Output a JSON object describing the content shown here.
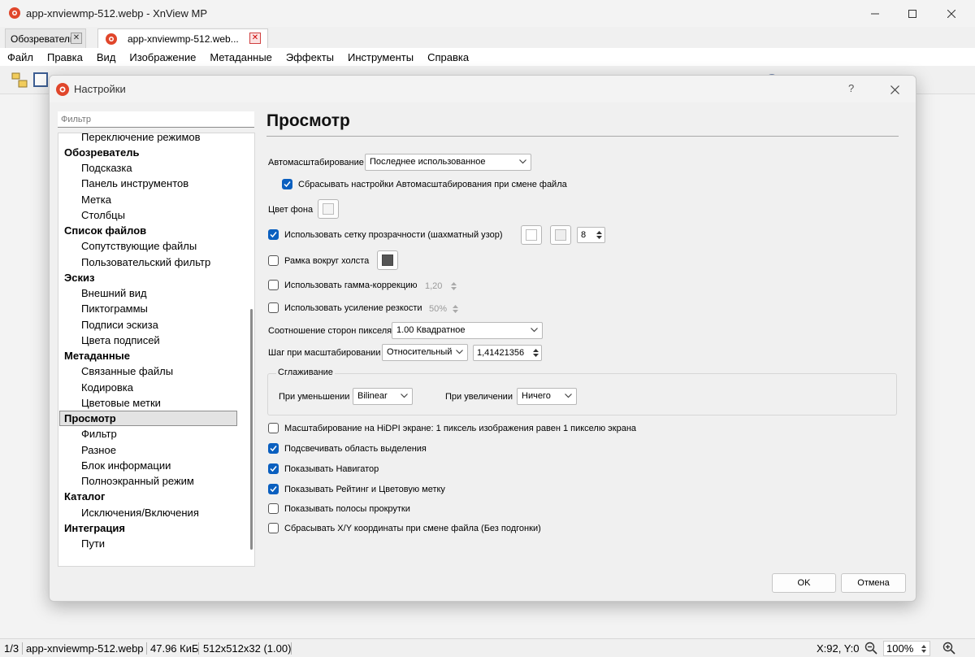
{
  "app": {
    "title": "app-xnviewmp-512.webp - XnView MP"
  },
  "tabs": [
    {
      "label": "Обозреватель"
    },
    {
      "label": "app-xnviewmp-512.web..."
    }
  ],
  "menu": [
    "Файл",
    "Правка",
    "Вид",
    "Изображение",
    "Метаданные",
    "Эффекты",
    "Инструменты",
    "Справка"
  ],
  "dialog": {
    "title": "Настройки",
    "help": "?",
    "filter_placeholder": "Фильтр",
    "tree": [
      {
        "label": "Переключение режимов",
        "level": 2
      },
      {
        "label": "Обозреватель",
        "level": 1
      },
      {
        "label": "Подсказка",
        "level": 2
      },
      {
        "label": "Панель инструментов",
        "level": 2
      },
      {
        "label": "Метка",
        "level": 2
      },
      {
        "label": "Столбцы",
        "level": 2
      },
      {
        "label": "Список файлов",
        "level": 1
      },
      {
        "label": "Сопутствующие файлы",
        "level": 2
      },
      {
        "label": "Пользовательский фильтр",
        "level": 2
      },
      {
        "label": "Эскиз",
        "level": 1
      },
      {
        "label": "Внешний вид",
        "level": 2
      },
      {
        "label": "Пиктограммы",
        "level": 2
      },
      {
        "label": "Подписи эскиза",
        "level": 2
      },
      {
        "label": "Цвета подписей",
        "level": 2
      },
      {
        "label": "Метаданные",
        "level": 1
      },
      {
        "label": "Связанные файлы",
        "level": 2
      },
      {
        "label": "Кодировка",
        "level": 2
      },
      {
        "label": "Цветовые метки",
        "level": 2
      },
      {
        "label": "Просмотр",
        "level": 1,
        "selected": true
      },
      {
        "label": "Фильтр",
        "level": 2
      },
      {
        "label": "Разное",
        "level": 2
      },
      {
        "label": "Блок информации",
        "level": 2
      },
      {
        "label": "Полноэкранный режим",
        "level": 2
      },
      {
        "label": "Каталог",
        "level": 1
      },
      {
        "label": "Исключения/Включения",
        "level": 2
      },
      {
        "label": "Интеграция",
        "level": 1
      },
      {
        "label": "Пути",
        "level": 2
      }
    ],
    "section_title": "Просмотр",
    "autoscale": {
      "label": "Автомасштабирование",
      "value": "Последнее использованное",
      "reset_label": "Сбрасывать настройки Автомасштабирования при смене файла",
      "reset_checked": true
    },
    "background": {
      "label": "Цвет фона",
      "color": "#f4f4f4"
    },
    "transparency": {
      "label": "Использовать сетку прозрачности (шахматный узор)",
      "checked": true,
      "color1": "#ffffff",
      "color2": "#eeeeee",
      "size": "8"
    },
    "canvas_frame": {
      "label": "Рамка вокруг холста",
      "checked": false,
      "color": "#555555"
    },
    "gamma": {
      "label": "Использовать гамма-коррекцию",
      "checked": false,
      "value": "1,20"
    },
    "sharpen": {
      "label": "Использовать усиление резкости",
      "checked": false,
      "value": "50%"
    },
    "pixel_ratio": {
      "label": "Соотношение сторон пикселя",
      "value": "1.00  Квадратное"
    },
    "zoom_step": {
      "label": "Шаг при масштабировании",
      "mode": "Относительный",
      "value": "1,41421356"
    },
    "smoothing": {
      "title": "Сглаживание",
      "down_label": "При уменьшении",
      "down_value": "Bilinear",
      "up_label": "При увеличении",
      "up_value": "Ничего"
    },
    "options": [
      {
        "label": "Масштабирование на HiDPI экране: 1 пиксель изображения равен 1 пикселю экрана",
        "checked": false
      },
      {
        "label": "Подсвечивать область выделения",
        "checked": true
      },
      {
        "label": "Показывать Навигатор",
        "checked": true
      },
      {
        "label": "Показывать Рейтинг и Цветовую метку",
        "checked": true
      },
      {
        "label": "Показывать полосы прокрутки",
        "checked": false
      },
      {
        "label": "Сбрасывать X/Y координаты при смене файла (Без подгонки)",
        "checked": false
      }
    ],
    "ok_label": "OK",
    "cancel_label": "Отмена"
  },
  "status": {
    "index": "1/3",
    "filename": "app-xnviewmp-512.webp",
    "size": "47.96 КиБ",
    "dimensions": "512x512x32 (1.00)",
    "coords": "X:92, Y:0",
    "zoom": "100%"
  },
  "colors": {
    "accent": "#0a5fbf",
    "logo": "#e0462b"
  }
}
